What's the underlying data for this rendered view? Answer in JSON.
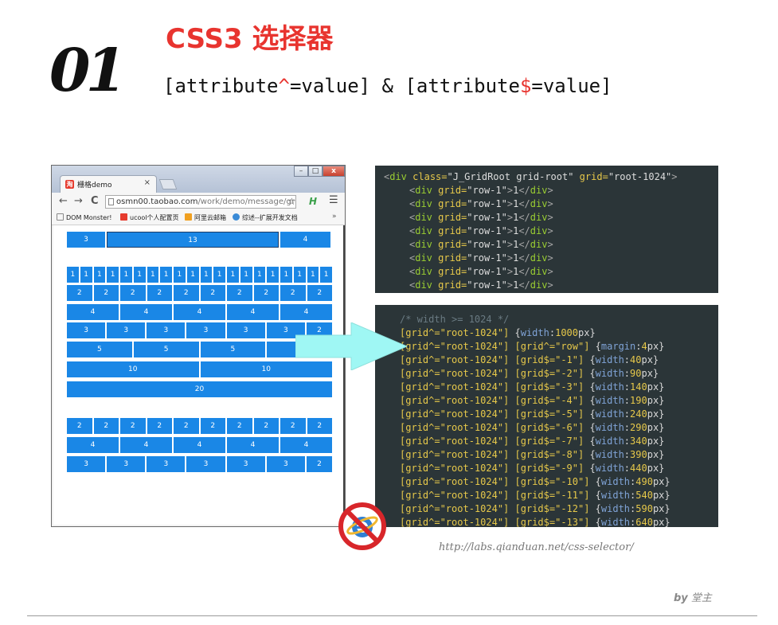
{
  "slide": {
    "number": "01",
    "title": "CSS3 选择器",
    "subtitle_parts": [
      "[attribute",
      "^",
      "=value] & [attribute",
      "$",
      "=value]"
    ],
    "url": "http://labs.qianduan.net/css-selector/",
    "by_label": "by",
    "author": "堂主"
  },
  "browser": {
    "tab_title": "栅格demo",
    "tab_close": "×",
    "tab_favicon": "淘",
    "window_buttons": {
      "min": "–",
      "max": "□",
      "close": "x"
    },
    "nav": {
      "back": "←",
      "forward": "→",
      "reload": "C"
    },
    "address_host": "osmn00.taobao.com",
    "address_path": "/work/demo/message/gr",
    "bookmarks": [
      {
        "label": "DOM Monster!",
        "color": "#ffffff"
      },
      {
        "label": "ucool个人配置页",
        "color": "#e63b2e"
      },
      {
        "label": "阿里云邮箱",
        "color": "#f0a020"
      },
      {
        "label": "综述--扩展开发文档",
        "color": "#3a8ad6"
      }
    ],
    "bookmarks_more": "»",
    "grid_color": "#1a87e6"
  },
  "grid_rows": [
    [
      "3",
      "13",
      "4"
    ],
    [
      "1",
      "1",
      "1",
      "1",
      "1",
      "1",
      "1",
      "1",
      "1",
      "1",
      "1",
      "1",
      "1",
      "1",
      "1",
      "1",
      "1",
      "1",
      "1",
      "1"
    ],
    [
      "2",
      "2",
      "2",
      "2",
      "2",
      "2",
      "2",
      "2",
      "2",
      "2"
    ],
    [
      "4",
      "4",
      "4",
      "4",
      "4"
    ],
    [
      "3",
      "3",
      "3",
      "3",
      "3",
      "3",
      "2"
    ],
    [
      "5",
      "5",
      "5",
      "5"
    ],
    [
      "10",
      "10"
    ],
    [
      "20"
    ],
    [
      "2",
      "2",
      "2",
      "2",
      "2",
      "2",
      "2",
      "2",
      "2",
      "2"
    ],
    [
      "4",
      "4",
      "4",
      "4",
      "4"
    ],
    [
      "3",
      "3",
      "3",
      "3",
      "3",
      "3",
      "2"
    ]
  ],
  "html_code": {
    "root_open": [
      "<",
      "div",
      " class=",
      "\"J_GridRoot grid-root\"",
      " grid=",
      "\"root-1024\"",
      ">"
    ],
    "row_tag": "div",
    "row_attr": " grid=",
    "row_value": "\"row-1\"",
    "row_text": "1",
    "row_count": 8
  },
  "css_code": {
    "comment": "/* width >= 1024 */",
    "first_selector": "[grid^=\"root-1024\"]",
    "first_prop": "width",
    "first_value": "1000",
    "first_unit": "px",
    "second_selector_b": "[grid^=\"row\"]",
    "second_prop": "margin",
    "second_value": "4",
    "second_unit": "px",
    "rules": [
      {
        "suffix": "-1",
        "width": "40"
      },
      {
        "suffix": "-2",
        "width": "90"
      },
      {
        "suffix": "-3",
        "width": "140"
      },
      {
        "suffix": "-4",
        "width": "190"
      },
      {
        "suffix": "-5",
        "width": "240"
      },
      {
        "suffix": "-6",
        "width": "290"
      },
      {
        "suffix": "-7",
        "width": "340"
      },
      {
        "suffix": "-8",
        "width": "390"
      },
      {
        "suffix": "-9",
        "width": "440"
      },
      {
        "suffix": "-10",
        "width": "490"
      },
      {
        "suffix": "-11",
        "width": "540"
      },
      {
        "suffix": "-12",
        "width": "590"
      },
      {
        "suffix": "-13",
        "width": "640"
      }
    ]
  },
  "colors": {
    "accent_red": "#e8342f",
    "code_bg": "#2b3538",
    "arrow": "#9ff7f4"
  }
}
